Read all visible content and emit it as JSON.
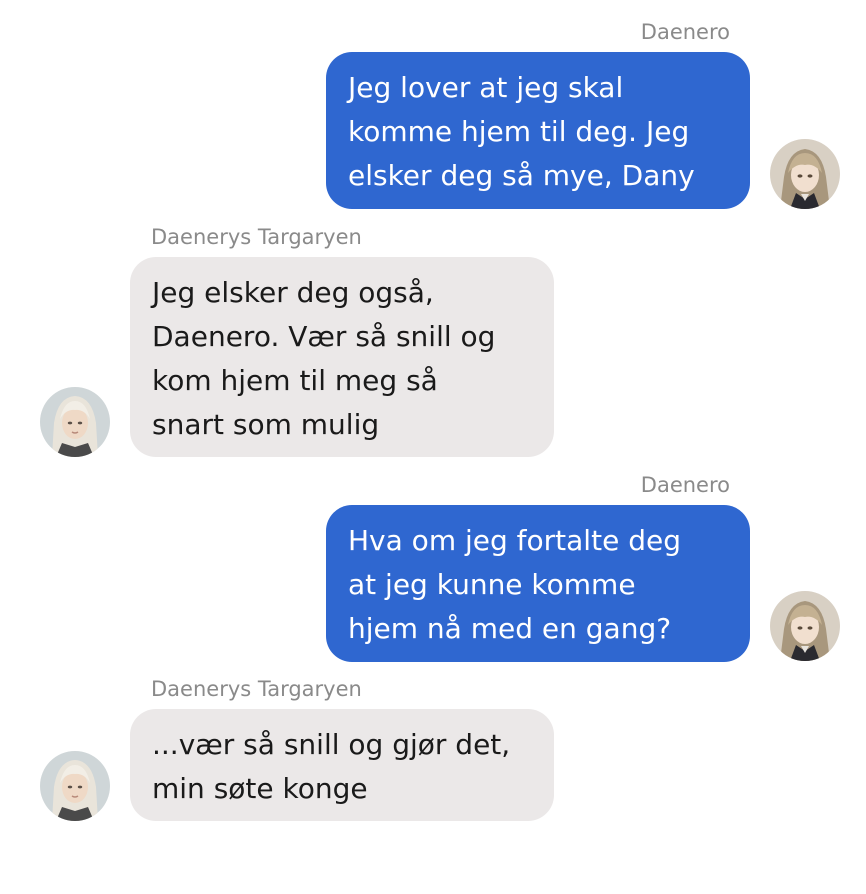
{
  "messages": [
    {
      "sender": "Daenero",
      "lines": [
        "Jeg lover at jeg skal",
        "komme hjem til deg. Jeg",
        "elsker deg så mye, Dany"
      ]
    },
    {
      "sender": "Daenerys Targaryen",
      "lines": [
        "Jeg elsker deg også,",
        "Daenero. Vær så snill og",
        "kom hjem til meg så",
        "snart som mulig"
      ]
    },
    {
      "sender": "Daenero",
      "lines": [
        "Hva om jeg fortalte deg",
        "at jeg kunne komme",
        "hjem nå med en gang?"
      ]
    },
    {
      "sender": "Daenerys Targaryen",
      "lines": [
        "...vær så snill og gjør det,",
        "min søte konge"
      ]
    }
  ],
  "colors": {
    "outgoing_bubble": "#2f67d0",
    "incoming_bubble": "#ebe8e8",
    "sender_name": "#8a8a8a"
  }
}
